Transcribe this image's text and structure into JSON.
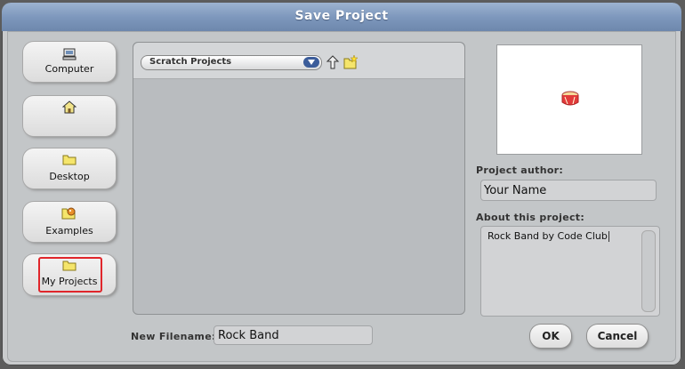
{
  "dialog": {
    "title": "Save Project"
  },
  "sidebar": {
    "items": [
      {
        "id": "computer",
        "label": "Computer",
        "icon": "computer-icon"
      },
      {
        "id": "home",
        "label": "",
        "icon": "home-icon"
      },
      {
        "id": "desktop",
        "label": "Desktop",
        "icon": "folder-icon"
      },
      {
        "id": "examples",
        "label": "Examples",
        "icon": "examples-icon"
      },
      {
        "id": "my-projects",
        "label": "My Projects",
        "icon": "folder-icon",
        "selected": true
      }
    ]
  },
  "file_browser": {
    "location": "Scratch Projects",
    "up_icon": "up-folder-icon",
    "new_folder_icon": "new-folder-icon",
    "files": []
  },
  "project": {
    "author_label": "Project author:",
    "author_value": "Your Name",
    "about_label": "About this project:",
    "about_value": "Rock Band by Code Club"
  },
  "filename": {
    "label": "New Filename:",
    "value": "Rock Band"
  },
  "buttons": {
    "ok": "OK",
    "cancel": "Cancel"
  },
  "colors": {
    "title_bar": "#7e98bd",
    "selection_outline": "#e0262b",
    "dialog_bg": "#c9cbcd"
  }
}
